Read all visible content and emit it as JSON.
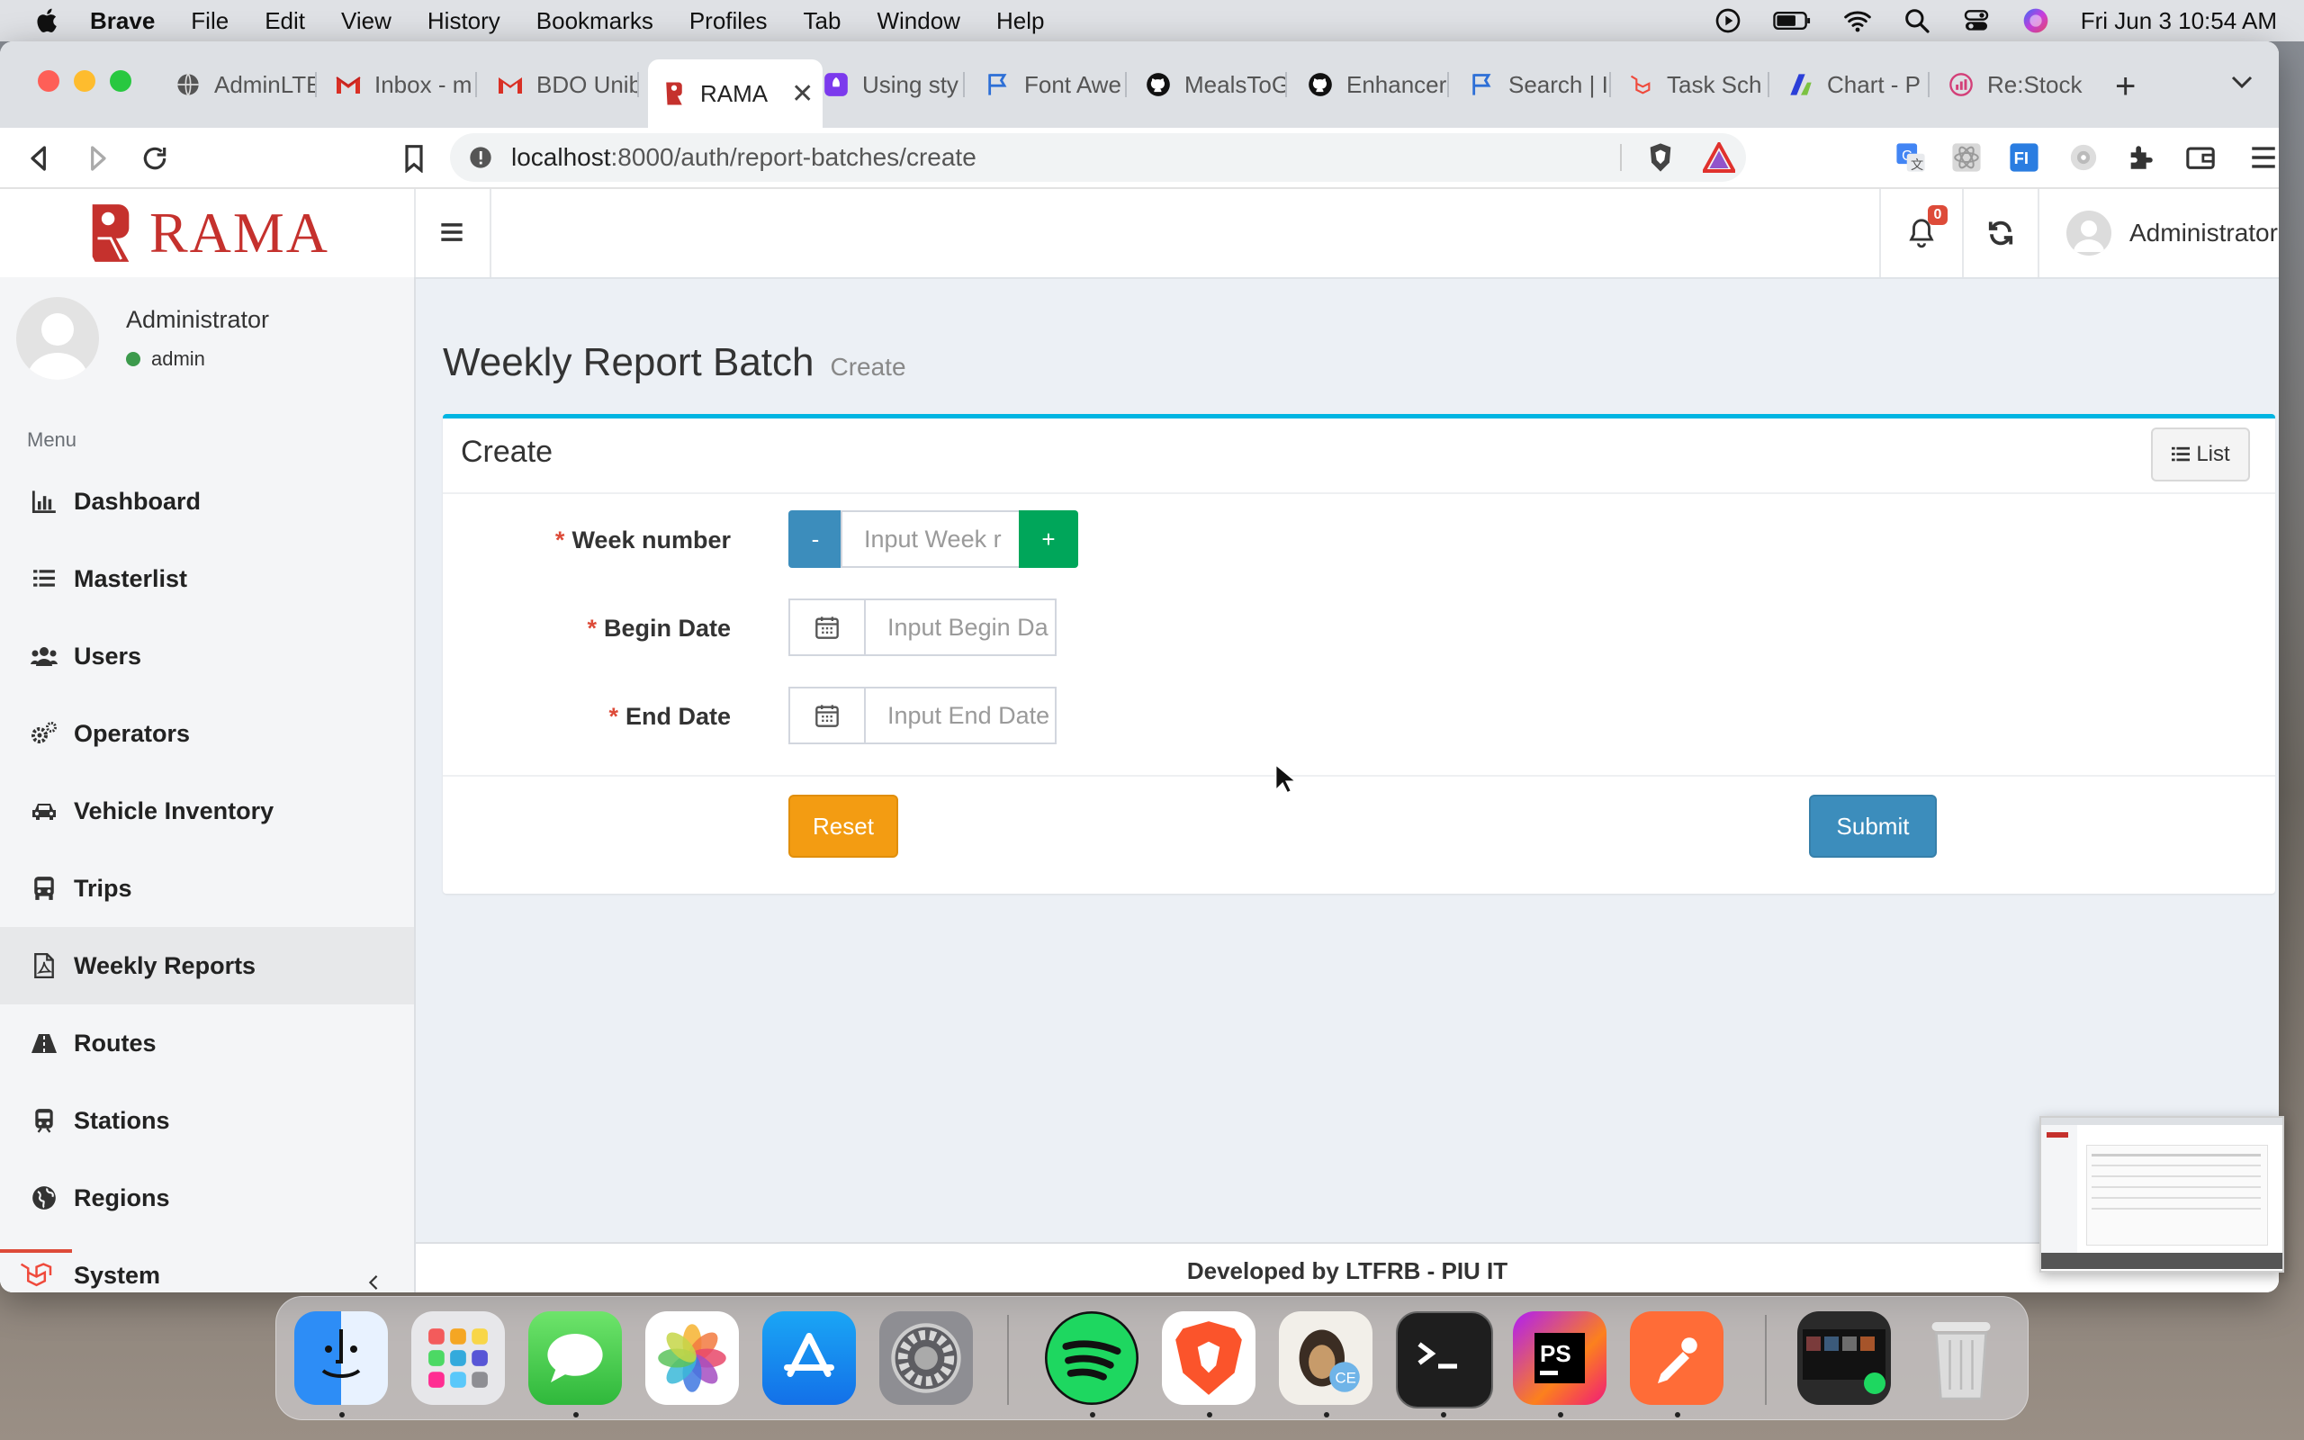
{
  "menubar": {
    "app_name": "Brave",
    "items": [
      "File",
      "Edit",
      "View",
      "History",
      "Bookmarks",
      "Profiles",
      "Tab",
      "Window",
      "Help"
    ],
    "clock": "Fri Jun 3  10:54 AM"
  },
  "browser": {
    "tabs": [
      {
        "label": "AdminLTE",
        "icon": "globe-icon"
      },
      {
        "label": "Inbox - m",
        "icon": "gmail-icon"
      },
      {
        "label": "BDO Unib",
        "icon": "gmail-icon"
      },
      {
        "label": "RAMA",
        "icon": "rama-icon",
        "active": true
      },
      {
        "label": "Using sty",
        "icon": "rocket-icon"
      },
      {
        "label": "Font Awe",
        "icon": "flag-icon"
      },
      {
        "label": "MealsToG",
        "icon": "github-icon"
      },
      {
        "label": "Enhancer",
        "icon": "github-icon"
      },
      {
        "label": "Search | I",
        "icon": "flag-icon"
      },
      {
        "label": "Task Sch",
        "icon": "laravel-icon"
      },
      {
        "label": "Chart - P",
        "icon": "chart-icon"
      },
      {
        "label": "Re:Stock",
        "icon": "restock-icon"
      }
    ],
    "url_host": "localhost",
    "url_path": ":8000/auth/report-batches/create"
  },
  "app": {
    "brand": "RAMA",
    "notification_count": "0",
    "header_user": "Administrator",
    "sidebar": {
      "user_name": "Administrator",
      "user_role": "admin",
      "menu_header": "Menu",
      "items": [
        {
          "label": "Dashboard",
          "icon": "bar-chart-icon"
        },
        {
          "label": "Masterlist",
          "icon": "list-icon"
        },
        {
          "label": "Users",
          "icon": "users-icon"
        },
        {
          "label": "Operators",
          "icon": "cogs-icon"
        },
        {
          "label": "Vehicle Inventory",
          "icon": "car-icon"
        },
        {
          "label": "Trips",
          "icon": "bus-icon"
        },
        {
          "label": "Weekly Reports",
          "icon": "file-pdf-icon",
          "active": true
        },
        {
          "label": "Routes",
          "icon": "road-icon"
        },
        {
          "label": "Stations",
          "icon": "train-icon"
        },
        {
          "label": "Regions",
          "icon": "globe-icon"
        },
        {
          "label": "System",
          "icon": "cog-icon"
        }
      ]
    },
    "page_title": "Weekly Report Batch",
    "page_subtitle": "Create",
    "box_title": "Create",
    "list_button": "List",
    "form": {
      "week_number_label": "Week number",
      "week_number_placeholder": "Input Week r",
      "minus_label": "-",
      "plus_label": "+",
      "begin_date_label": "Begin Date",
      "begin_date_placeholder": "Input Begin Da",
      "end_date_label": "End Date",
      "end_date_placeholder": "Input End Date",
      "required_mark": "*"
    },
    "reset_label": "Reset",
    "submit_label": "Submit",
    "footer_text": "Developed by LTFRB - PIU IT"
  },
  "colors": {
    "accent": "#00b5e2",
    "brand_red": "#c5312d",
    "btn_primary": "#3c8dbc",
    "btn_success": "#00a65a",
    "btn_warning": "#f39c12"
  }
}
